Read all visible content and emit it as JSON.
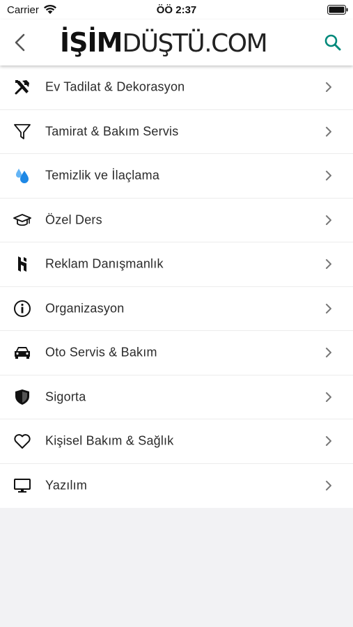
{
  "status_bar": {
    "carrier": "Carrier",
    "time": "ÖÖ 2:37"
  },
  "header": {
    "logo_bold": "İŞİM",
    "logo_light": "DÜŞTÜ.COM",
    "accent_color": "#00897b"
  },
  "categories": [
    {
      "label": "Ev Tadilat & Dekorasyon",
      "icon": "tools-icon"
    },
    {
      "label": "Tamirat & Bakım Servis",
      "icon": "funnel-icon"
    },
    {
      "label": "Temizlik ve İlaçlama",
      "icon": "water-drops-icon"
    },
    {
      "label": "Özel Ders",
      "icon": "graduation-cap-icon"
    },
    {
      "label": "Reklam Danışmanlık",
      "icon": "houzz-logo-icon"
    },
    {
      "label": "Organizasyon",
      "icon": "info-icon"
    },
    {
      "label": "Oto Servis & Bakım",
      "icon": "car-icon"
    },
    {
      "label": "Sigorta",
      "icon": "shield-icon"
    },
    {
      "label": "Kişisel Bakım & Sağlık",
      "icon": "heart-icon"
    },
    {
      "label": "Yazılım",
      "icon": "monitor-icon"
    }
  ]
}
